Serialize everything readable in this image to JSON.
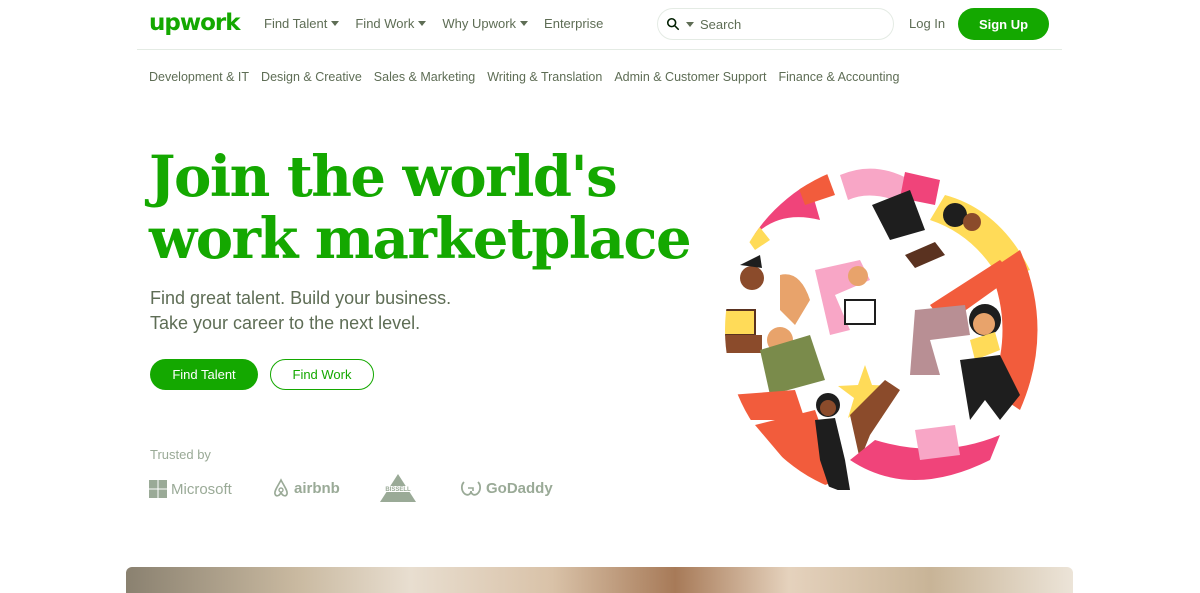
{
  "brand": {
    "logo_text": "upwork",
    "accent": "#14a800"
  },
  "nav": {
    "items": [
      {
        "label": "Find Talent",
        "has_dropdown": true
      },
      {
        "label": "Find Work",
        "has_dropdown": true
      },
      {
        "label": "Why Upwork",
        "has_dropdown": true
      },
      {
        "label": "Enterprise",
        "has_dropdown": false
      }
    ],
    "search_placeholder": "Search",
    "login_label": "Log In",
    "signup_label": "Sign Up"
  },
  "categories": [
    "Development & IT",
    "Design & Creative",
    "Sales & Marketing",
    "Writing & Translation",
    "Admin & Customer Support",
    "Finance & Accounting"
  ],
  "hero": {
    "title_line1": "Join the world's",
    "title_line2": "work marketplace",
    "subtitle_line1": "Find great talent. Build your business.",
    "subtitle_line2": "Take your career to the next level.",
    "primary_cta": "Find Talent",
    "secondary_cta": "Find Work"
  },
  "trusted": {
    "label": "Trusted by",
    "logos": [
      {
        "name": "Microsoft",
        "icon": "microsoft-logo"
      },
      {
        "name": "airbnb",
        "icon": "airbnb-logo"
      },
      {
        "name": "BISSELL",
        "icon": "bissell-logo"
      },
      {
        "name": "GoDaddy",
        "icon": "godaddy-logo"
      }
    ]
  }
}
